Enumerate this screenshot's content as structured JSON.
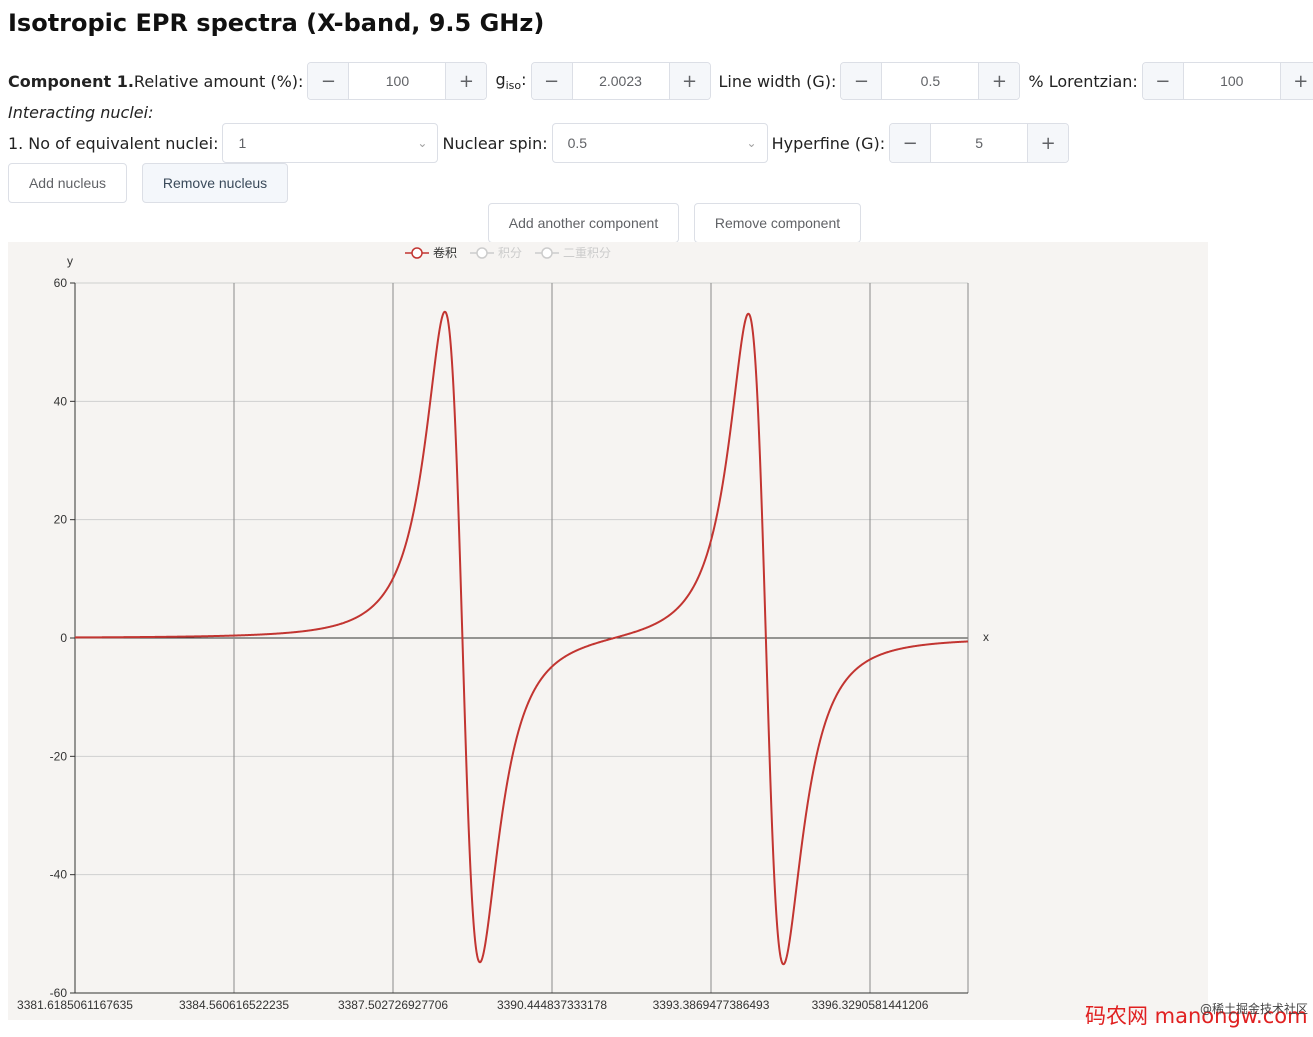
{
  "title": "Isotropic EPR spectra (X-band, 9.5 GHz)",
  "component": {
    "heading": "Component 1.",
    "relative_amount": {
      "label": "Relative amount (%):",
      "value": "100"
    },
    "giso": {
      "label_main": "g",
      "label_sub": "iso",
      "label_suffix": ":",
      "value": "2.0023"
    },
    "line_width": {
      "label": "Line width (G):",
      "value": "0.5"
    },
    "lorentzian": {
      "label": "% Lorentzian:",
      "value": "100"
    },
    "minus_glyph": "−",
    "plus_glyph": "+"
  },
  "nuclei": {
    "heading": "Interacting nuclei:",
    "row_prefix": "1.",
    "equivalent_label": "No of equivalent nuclei:",
    "equivalent_value": "1",
    "spin_label": "Nuclear spin:",
    "spin_value": "0.5",
    "hyperfine_label": "Hyperfine (G):",
    "hyperfine_value": "5"
  },
  "buttons": {
    "add_nucleus": "Add nucleus",
    "remove_nucleus": "Remove nucleus",
    "add_component": "Add another component",
    "remove_component": "Remove component"
  },
  "chart_data": {
    "type": "line",
    "xlabel": "x",
    "ylabel": "y",
    "xlim": [
      3381.6185061167635,
      3396.3290581441206
    ],
    "ylim": [
      -60,
      60
    ],
    "x_ticks": [
      "3381.6185061167635",
      "3384.560616522235",
      "3387.502726927706",
      "3390.444837333178",
      "3393.3869477386493",
      "3396.3290581441206"
    ],
    "y_ticks": [
      "60",
      "40",
      "20",
      "0",
      "-20",
      "-40",
      "-60"
    ],
    "grid": true,
    "legend_position": "top-center",
    "series": [
      {
        "name": "卷积",
        "color": "#c23531",
        "active": true,
        "center_fields": [
          3388.0,
          3393.0
        ],
        "peak": 55,
        "trough": -55
      },
      {
        "name": "积分",
        "color": "#cccccc",
        "active": false
      },
      {
        "name": "二重积分",
        "color": "#cccccc",
        "active": false
      }
    ]
  },
  "watermark": "码农网 manongw.com",
  "credit": "@稀土掘金技术社区"
}
